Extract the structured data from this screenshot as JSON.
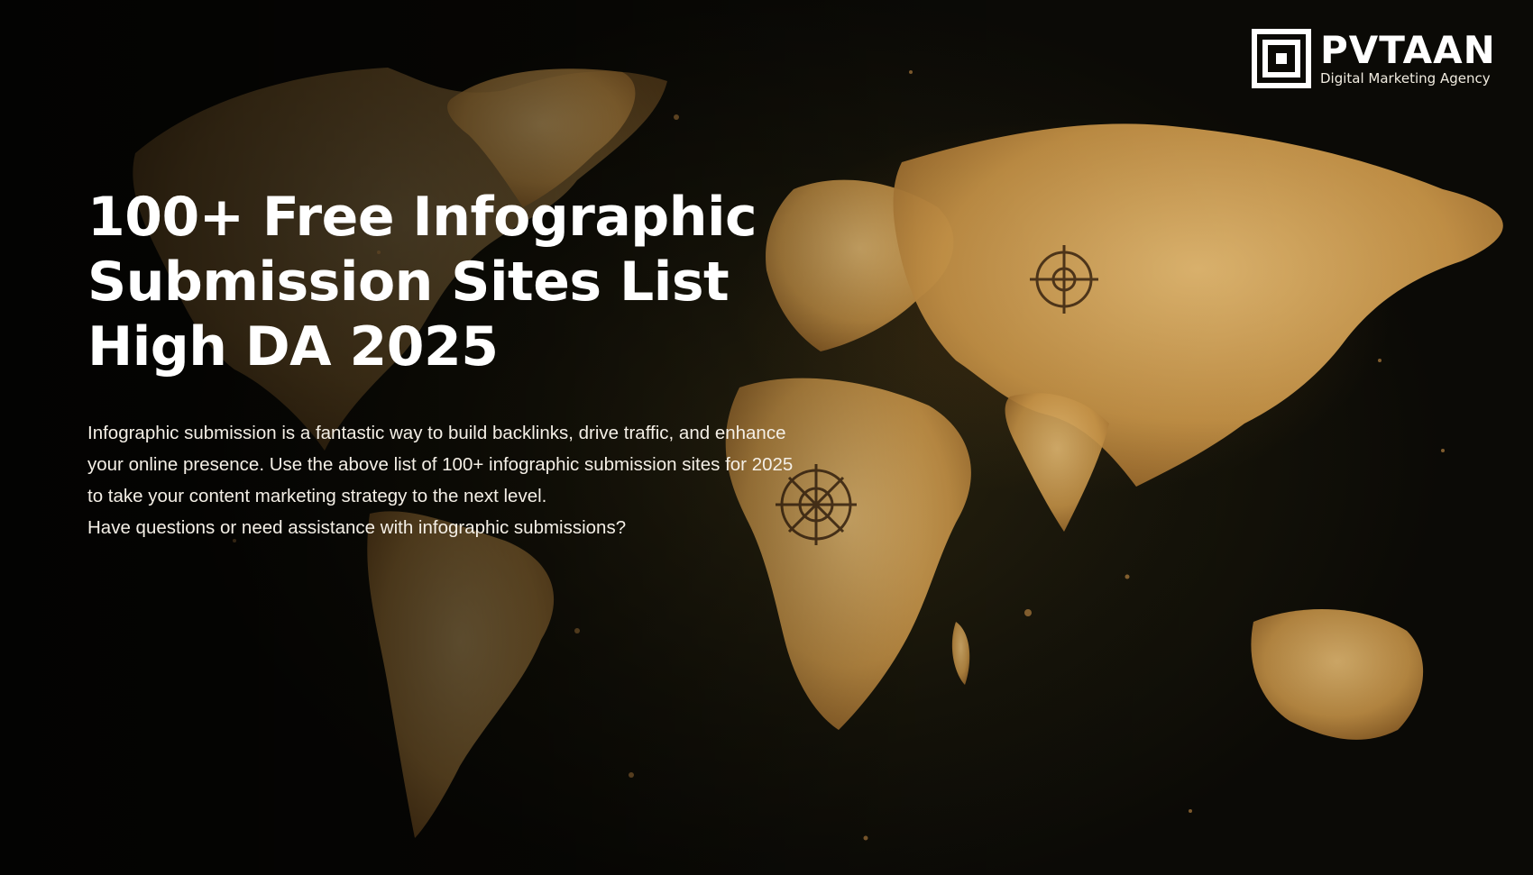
{
  "background": {
    "icon": "world-map-antique",
    "accent": "#c8964a",
    "land_color": "#d9aa63",
    "sea_color": "#151309"
  },
  "brand": {
    "logo_icon": "square-spiral-logo-icon",
    "name": "PVTAAN",
    "tagline": "Digital Marketing Agency"
  },
  "hero": {
    "title": "100+ Free Infographic Submission Sites List High DA 2025",
    "paragraph": "Infographic submission is a fantastic way to build backlinks, drive traffic, and enhance your online presence. Use the above list of 100+ infographic submission sites for 2025 to take your content marketing strategy to the next level.",
    "question": "Have questions or need assistance with infographic submissions?"
  }
}
